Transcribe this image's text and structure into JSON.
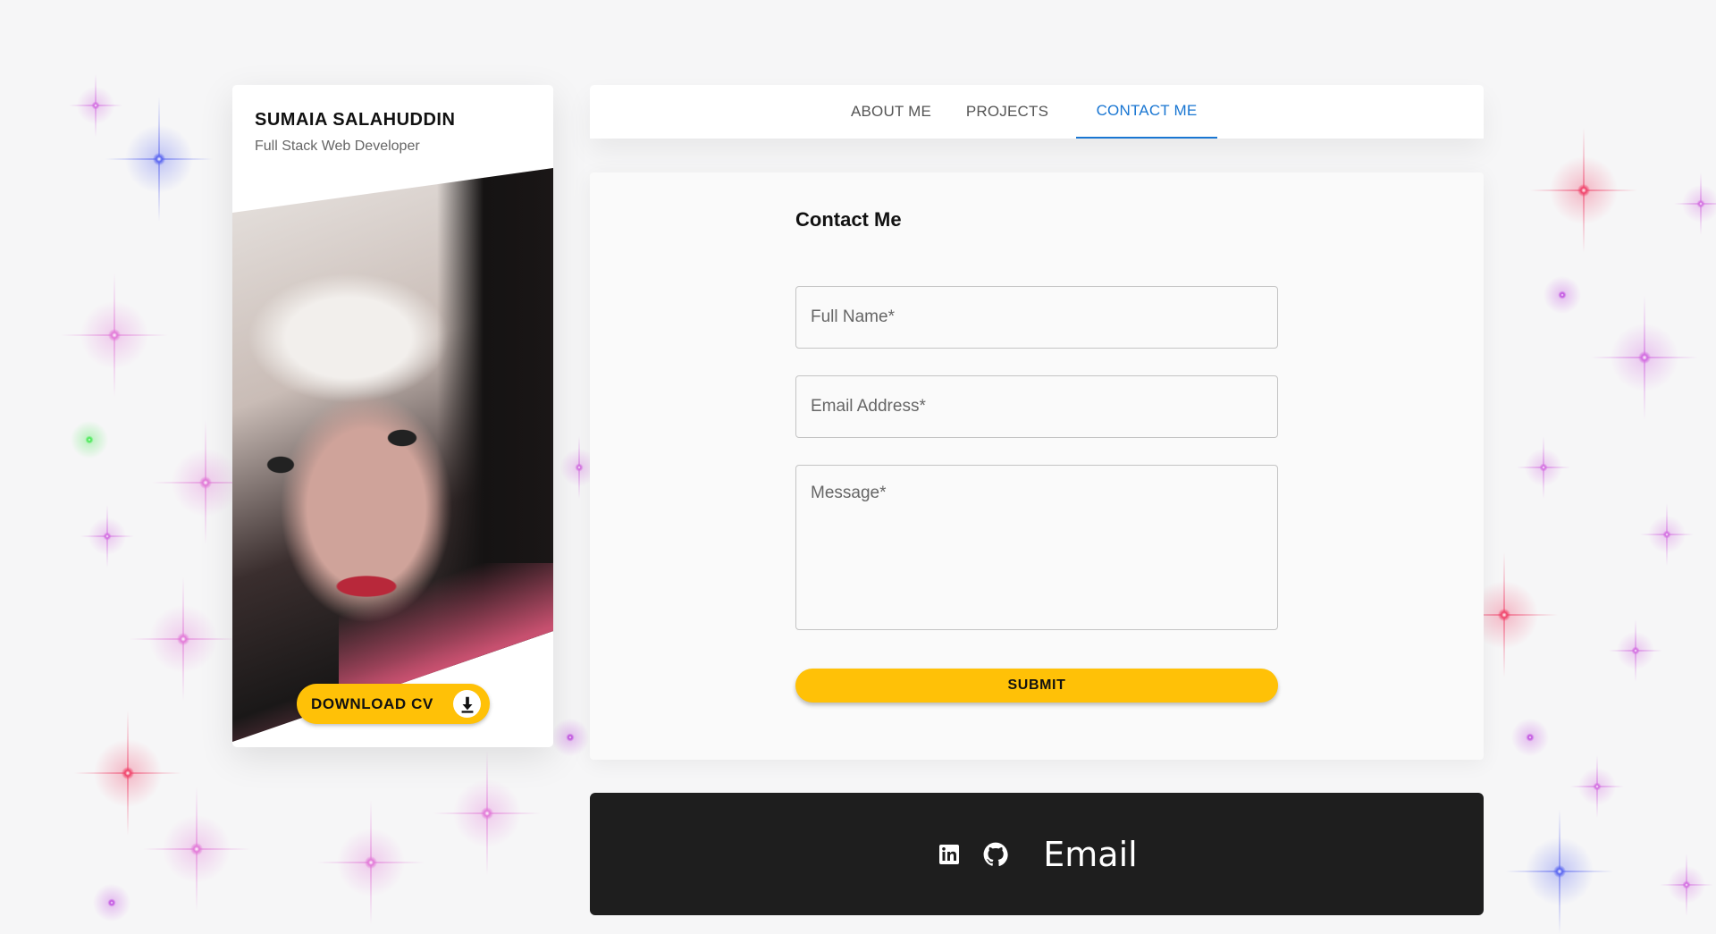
{
  "profile": {
    "name": "SUMAIA SALAHUDDIN",
    "role": "Full Stack Web Developer",
    "download_label": "DOWNLOAD CV",
    "download_icon": "download-icon"
  },
  "tabs": [
    {
      "label": "ABOUT ME",
      "active": false
    },
    {
      "label": "PROJECTS",
      "active": false
    },
    {
      "label": "CONTACT ME",
      "active": true
    }
  ],
  "contact": {
    "title": "Contact Me",
    "full_name_placeholder": "Full Name*",
    "email_placeholder": "Email Address*",
    "message_placeholder": "Message*",
    "submit_label": "SUBMIT"
  },
  "footer": {
    "linkedin_icon": "linkedin-icon",
    "github_icon": "github-icon",
    "email_label": "Email"
  },
  "colors": {
    "accent": "#ffc107",
    "tab_active": "#1976d2",
    "footer_bg": "#1e1e1e",
    "page_bg": "#f6f6f7"
  }
}
